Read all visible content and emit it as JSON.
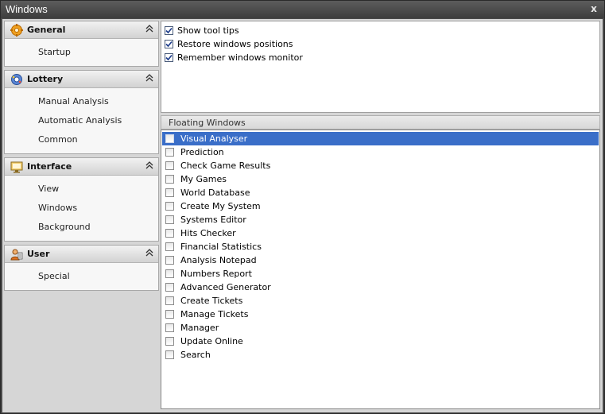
{
  "window": {
    "title": "Windows",
    "close_label": "x"
  },
  "nav": {
    "groups": [
      {
        "title": "General",
        "icon": "gear-icon",
        "items": [
          "Startup"
        ]
      },
      {
        "title": "Lottery",
        "icon": "lottery-balls-icon",
        "items": [
          "Manual Analysis",
          "Automatic Analysis",
          "Common"
        ]
      },
      {
        "title": "Interface",
        "icon": "monitor-icon",
        "items": [
          "View",
          "Windows",
          "Background"
        ]
      },
      {
        "title": "User",
        "icon": "user-icon",
        "items": [
          "Special"
        ]
      }
    ]
  },
  "options": [
    {
      "label": "Show tool tips",
      "checked": true
    },
    {
      "label": "Restore windows positions",
      "checked": true
    },
    {
      "label": "Remember windows monitor",
      "checked": true
    }
  ],
  "floating": {
    "title": "Floating Windows",
    "items": [
      {
        "label": "Visual Analyser",
        "checked": false,
        "selected": true
      },
      {
        "label": "Prediction",
        "checked": false
      },
      {
        "label": "Check Game Results",
        "checked": false
      },
      {
        "label": "My Games",
        "checked": false
      },
      {
        "label": "World Database",
        "checked": false
      },
      {
        "label": "Create My System",
        "checked": false
      },
      {
        "label": "Systems Editor",
        "checked": false
      },
      {
        "label": "Hits Checker",
        "checked": false
      },
      {
        "label": "Financial Statistics",
        "checked": false
      },
      {
        "label": "Analysis Notepad",
        "checked": false
      },
      {
        "label": "Numbers Report",
        "checked": false
      },
      {
        "label": "Advanced Generator",
        "checked": false
      },
      {
        "label": "Create Tickets",
        "checked": false
      },
      {
        "label": "Manage Tickets",
        "checked": false
      },
      {
        "label": "Manager",
        "checked": false
      },
      {
        "label": "Update Online",
        "checked": false
      },
      {
        "label": "Search",
        "checked": false
      }
    ]
  }
}
